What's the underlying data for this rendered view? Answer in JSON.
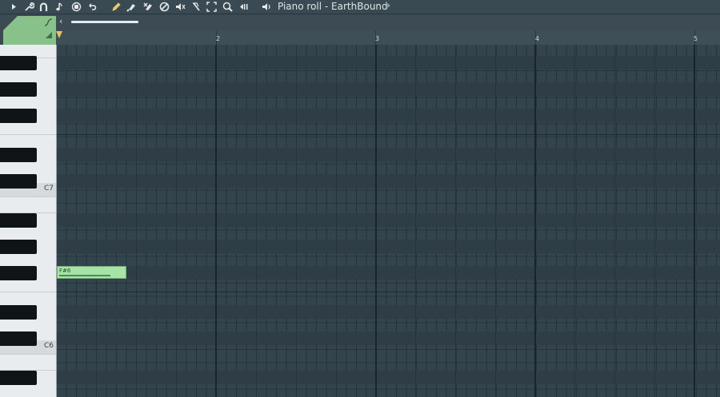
{
  "toolbar": {
    "title": "Piano roll - EarthBound",
    "buttons": [
      {
        "name": "menu-arrow-icon",
        "glyph": "▸"
      },
      {
        "name": "wrench-icon",
        "glyph": "🔧"
      },
      {
        "name": "magnet-icon",
        "glyph": "∩"
      },
      {
        "name": "note-icon",
        "glyph": "♪"
      },
      {
        "name": "record-icon",
        "glyph": "◉"
      },
      {
        "name": "undo-icon",
        "glyph": "↶"
      },
      {
        "name": "pencil-icon",
        "glyph": "✎"
      },
      {
        "name": "paint-brush-icon",
        "glyph": "🖌"
      },
      {
        "name": "delete-icon",
        "glyph": "✖"
      },
      {
        "name": "mute-icon",
        "glyph": "⊘"
      },
      {
        "name": "mute-speaker-icon",
        "glyph": "🔇"
      },
      {
        "name": "slice-icon",
        "glyph": "✂"
      },
      {
        "name": "select-icon",
        "glyph": "⬚"
      },
      {
        "name": "zoom-icon",
        "glyph": "🔍"
      },
      {
        "name": "playback-icon",
        "glyph": "◀"
      },
      {
        "name": "speaker-icon",
        "glyph": "🔈"
      }
    ]
  },
  "ruler": {
    "bar_numbers": [
      "2",
      "3",
      "4",
      "5"
    ]
  },
  "keyboard": {
    "octave_labels": [
      "C7",
      "C6"
    ]
  },
  "note": {
    "label": "F#6"
  },
  "colors": {
    "note": "#a5e3a6",
    "grid_bg": "#34444d",
    "accent_green": "#88c28a",
    "playhead": "#e6c463"
  }
}
